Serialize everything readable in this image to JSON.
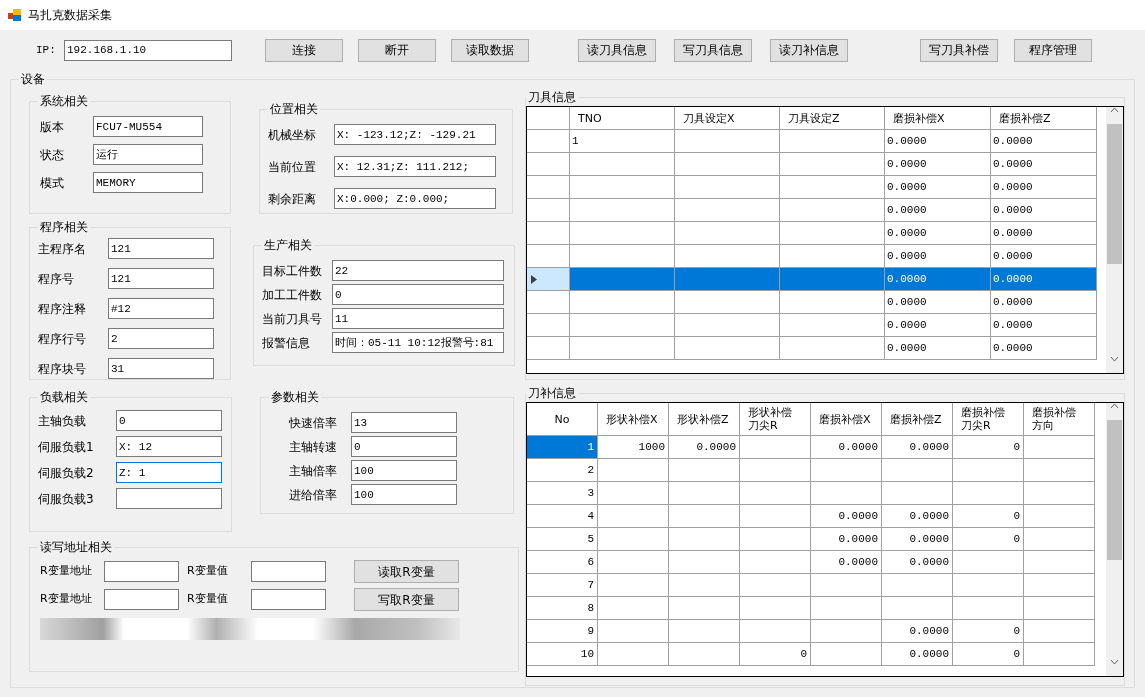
{
  "window": {
    "title": "马扎克数据采集"
  },
  "toolbar": {
    "ip_label": "IP:",
    "ip_value": "192.168.1.10",
    "button_groups": [
      [
        "连接",
        "断开",
        "读取数据"
      ],
      [
        "读刀具信息",
        "写刀具信息",
        "读刀补信息"
      ],
      [
        "写刀具补偿",
        "程序管理"
      ]
    ]
  },
  "device": {
    "title": "设备",
    "system": {
      "title": "系统相关",
      "fields": [
        {
          "label": "版本",
          "value": "FCU7-MU554"
        },
        {
          "label": "状态",
          "value": "运行"
        },
        {
          "label": "模式",
          "value": "MEMORY"
        }
      ]
    },
    "position": {
      "title": "位置相关",
      "fields": [
        {
          "label": "机械坐标",
          "value": "X: -123.12;Z: -129.21"
        },
        {
          "label": "当前位置",
          "value": "X: 12.31;Z: 111.212;"
        },
        {
          "label": "剩余距离",
          "value": "X:0.000; Z:0.000;"
        }
      ]
    },
    "program": {
      "title": "程序相关",
      "fields": [
        {
          "label": "主程序名",
          "value": "121"
        },
        {
          "label": "程序号",
          "value": "121"
        },
        {
          "label": "程序注释",
          "value": "#12"
        },
        {
          "label": "程序行号",
          "value": "2"
        },
        {
          "label": "程序块号",
          "value": "31"
        }
      ]
    },
    "production": {
      "title": "生产相关",
      "fields": [
        {
          "label": "目标工件数",
          "value": "22"
        },
        {
          "label": "加工工件数",
          "value": "0"
        },
        {
          "label": "当前刀具号",
          "value": "11"
        },
        {
          "label": "报警信息",
          "value": "时间：05-11 10:12报警号:81"
        }
      ]
    },
    "load": {
      "title": "负载相关",
      "fields": [
        {
          "label": "主轴负载",
          "value": "0",
          "focused": false
        },
        {
          "label": "伺服负载1",
          "value": "X: 12",
          "focused": false
        },
        {
          "label": "伺服负载2",
          "value": "Z: 1",
          "focused": true
        },
        {
          "label": "伺服负载3",
          "focused": false
        }
      ]
    },
    "params": {
      "title": "参数相关",
      "fields": [
        {
          "label": "快速倍率",
          "value": "13"
        },
        {
          "label": "主轴转速",
          "value": "0"
        },
        {
          "label": "主轴倍率",
          "value": "100"
        },
        {
          "label": "进给倍率",
          "value": "100"
        }
      ]
    },
    "rw": {
      "title": "读写地址相关",
      "rows": [
        {
          "address_label": "R变量地址",
          "value_label": "R变量值",
          "button": "读取R变量"
        },
        {
          "address_label": "R变量地址",
          "value_label": "R变量值",
          "button": "写取R变量"
        }
      ]
    }
  },
  "tool_info": {
    "title": "刀具信息",
    "columns": [
      "TNO",
      "刀具设定X",
      "刀具设定Z",
      "磨损补偿X",
      "磨损补偿Z"
    ],
    "rows": [
      {
        "cells": [
          "1",
          null,
          null,
          "0.0000",
          "0.0000"
        ],
        "selected": false
      },
      {
        "cells": [
          null,
          null,
          null,
          "0.0000",
          "0.0000"
        ],
        "selected": false
      },
      {
        "cells": [
          null,
          null,
          null,
          "0.0000",
          "0.0000"
        ],
        "selected": false
      },
      {
        "cells": [
          null,
          null,
          null,
          "0.0000",
          "0.0000"
        ],
        "selected": false
      },
      {
        "cells": [
          null,
          null,
          null,
          "0.0000",
          "0.0000"
        ],
        "selected": false
      },
      {
        "cells": [
          null,
          null,
          null,
          "0.0000",
          "0.0000"
        ],
        "selected": false
      },
      {
        "cells": [
          null,
          null,
          null,
          "0.0000",
          "0.0000"
        ],
        "selected": true
      },
      {
        "cells": [
          null,
          null,
          null,
          "0.0000",
          "0.0000"
        ],
        "selected": false
      },
      {
        "cells": [
          null,
          null,
          null,
          "0.0000",
          "0.0000"
        ],
        "selected": false
      },
      {
        "cells": [
          null,
          null,
          null,
          "0.0000",
          "0.0000"
        ],
        "selected": false
      }
    ]
  },
  "offset_info": {
    "title": "刀补信息",
    "columns": [
      "No",
      "形状补偿X",
      "形状补偿Z",
      "形状补偿刀尖R",
      "磨损补偿X",
      "磨损补偿Z",
      "磨损补偿刀尖R",
      "磨损补偿方向"
    ],
    "rows": [
      {
        "cells": [
          "1",
          "1000",
          "0.0000",
          null,
          "0.0000",
          "0.0000",
          "0",
          null
        ],
        "selected": true
      },
      {
        "cells": [
          "2",
          null,
          null,
          null,
          null,
          null,
          null,
          null
        ],
        "selected": false
      },
      {
        "cells": [
          "3",
          null,
          null,
          null,
          null,
          null,
          null,
          null
        ],
        "selected": false
      },
      {
        "cells": [
          "4",
          null,
          null,
          null,
          "0.0000",
          "0.0000",
          "0",
          null
        ],
        "selected": false
      },
      {
        "cells": [
          "5",
          null,
          null,
          null,
          "0.0000",
          "0.0000",
          "0",
          null
        ],
        "selected": false
      },
      {
        "cells": [
          "6",
          null,
          null,
          null,
          "0.0000",
          "0.0000",
          null,
          null
        ],
        "selected": false
      },
      {
        "cells": [
          "7",
          null,
          null,
          null,
          null,
          null,
          null,
          null
        ],
        "selected": false
      },
      {
        "cells": [
          "8",
          null,
          null,
          null,
          null,
          null,
          null,
          null
        ],
        "selected": false
      },
      {
        "cells": [
          "9",
          null,
          null,
          null,
          null,
          "0.0000",
          "0",
          null
        ],
        "selected": false
      },
      {
        "cells": [
          "10",
          null,
          null,
          "0",
          null,
          "0.0000",
          "0",
          null
        ],
        "selected": false
      }
    ]
  }
}
